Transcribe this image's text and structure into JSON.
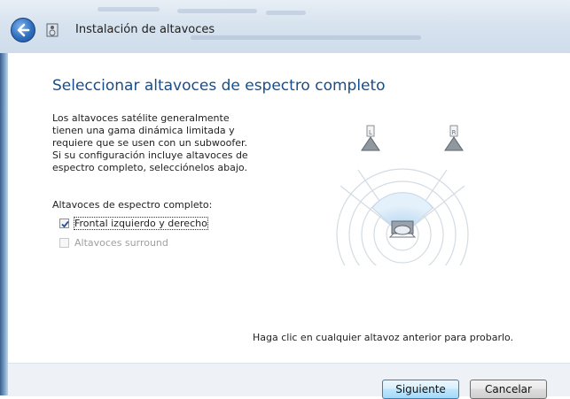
{
  "window": {
    "title": "Instalación de altavoces"
  },
  "page": {
    "heading": "Seleccionar altavoces de espectro completo",
    "description": "Los altavoces satélite generalmente\ntienen una gama dinámica limitada y\nrequiere que se usen con un subwoofer.\nSi su configuración incluye altavoces de\nespectro completo, selecciónelos abajo.",
    "group_label": "Altavoces de espectro completo:",
    "options": [
      {
        "label": "Frontal izquierdo y derecho",
        "checked": true,
        "enabled": true
      },
      {
        "label": "Altavoces surround",
        "checked": false,
        "enabled": false
      }
    ],
    "speaker_labels": {
      "left": "L",
      "right": "R"
    },
    "hint": "Haga clic en cualquier altavoz anterior para probarlo."
  },
  "buttons": {
    "next": "Siguiente",
    "cancel": "Cancelar"
  },
  "colors": {
    "heading": "#1a4d88",
    "accent": "#2f6fc0"
  },
  "icons": {
    "back": "back-arrow-icon",
    "app": "speaker-setup-icon"
  }
}
